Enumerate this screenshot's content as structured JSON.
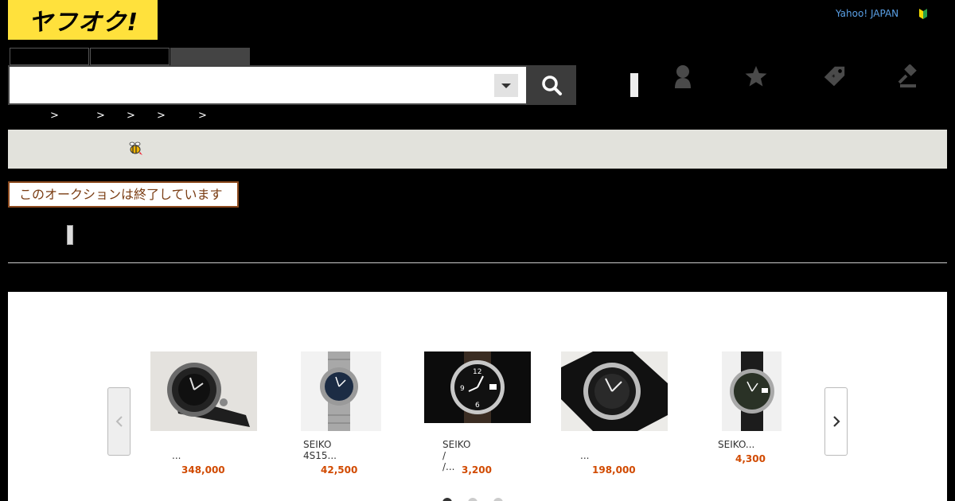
{
  "header": {
    "logo_text": "ヤフオク!",
    "yahoo_link": "Yahoo! JAPAN",
    "search": {
      "tabs": [
        "",
        "",
        ""
      ],
      "placeholder": ""
    },
    "icons": [
      "person-icon",
      "star-icon",
      "tag-icon",
      "gavel-icon"
    ]
  },
  "breadcrumb": {
    "separators": [
      ">",
      ">",
      ">",
      ">",
      ">"
    ]
  },
  "notice": {
    "ended_label": "このオークションは終了しています"
  },
  "recommendations": {
    "items": [
      {
        "title": "...",
        "price": "348,000"
      },
      {
        "title": "SEIKO\n4S15...",
        "price": "42,500"
      },
      {
        "title": "SEIKO /\n/...",
        "price": "3,200"
      },
      {
        "title": "...",
        "price": "198,000"
      },
      {
        "title": "SEIKO...",
        "price": "4,300"
      }
    ],
    "page_count": 3,
    "active_page": 1
  },
  "colors": {
    "logo_yellow": "#ffe13c",
    "price_orange": "#d14a00",
    "ended_border": "#8c4a1e",
    "link_blue": "#5aa0e6"
  }
}
